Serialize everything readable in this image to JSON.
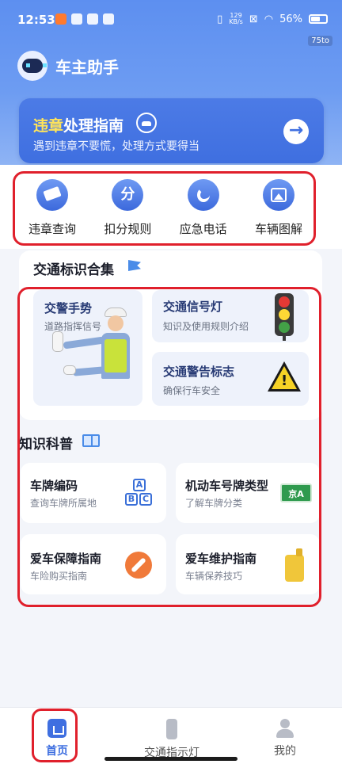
{
  "status_bar": {
    "time": "12:53",
    "net_speed_top": "129",
    "net_speed_unit": "KB/s",
    "battery": "56%",
    "corner_tag": "75to"
  },
  "app": {
    "title": "车主助手"
  },
  "banner": {
    "title_highlight": "违章",
    "title_rest": "处理指南",
    "subtitle": "遇到违章不要慌，处理方式要得当",
    "arrow": "→"
  },
  "quick_actions": [
    {
      "label": "违章查询",
      "icon": "camera-icon"
    },
    {
      "label": "扣分规则",
      "icon_text": "分",
      "icon": "points-icon"
    },
    {
      "label": "应急电话",
      "icon": "phone-icon"
    },
    {
      "label": "车辆图解",
      "icon": "picture-icon"
    }
  ],
  "signs_section": {
    "title": "交通标识合集",
    "tiles": [
      {
        "title": "交警手势",
        "subtitle": "道路指挥信号"
      },
      {
        "title": "交通信号灯",
        "subtitle": "知识及使用规则介绍"
      },
      {
        "title": "交通警告标志",
        "subtitle": "确保行车安全",
        "icon_text": "!"
      }
    ]
  },
  "knowledge_section": {
    "title": "知识科普",
    "cards": [
      {
        "title": "车牌编码",
        "subtitle": "查询车牌所属地",
        "icon_text": [
          "A",
          "B",
          "C"
        ]
      },
      {
        "title": "机动车号牌类型",
        "subtitle": "了解车牌分类",
        "icon_text": "京A"
      },
      {
        "title": "爱车保障指南",
        "subtitle": "车险购买指南"
      },
      {
        "title": "爱车维护指南",
        "subtitle": "车辆保养技巧"
      }
    ]
  },
  "bottom_nav": [
    {
      "label": "首页",
      "active": true
    },
    {
      "label": "交通指示灯",
      "active": false
    },
    {
      "label": "我的",
      "active": false
    }
  ],
  "colors": {
    "accent": "#3f6fe0",
    "highlight": "#ffe45a",
    "annotation_red": "#e0202c"
  }
}
